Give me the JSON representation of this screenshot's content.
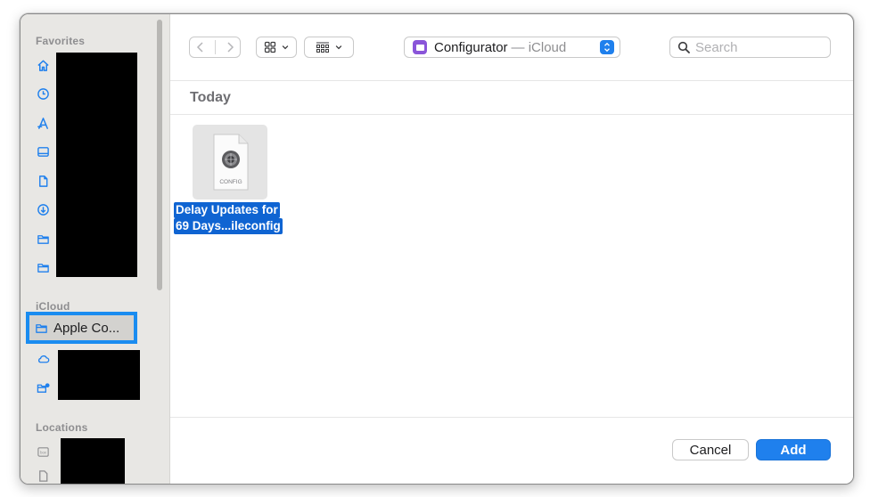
{
  "sidebar": {
    "favorites_label": "Favorites",
    "icloud_label": "iCloud",
    "locations_label": "Locations",
    "favorites_icons": [
      "home-icon",
      "recents-clock-icon",
      "applications-icon",
      "desktop-icon",
      "documents-icon",
      "downloads-icon",
      "folder-icon",
      "folder-icon"
    ],
    "selected_item": {
      "label": "Apple Co...",
      "icon": "folder-icon"
    },
    "icloud_icons": [
      "icloud-drive-icon",
      "shared-folder-icon"
    ],
    "locations_icons": [
      "box-drive-icon",
      "document-icon"
    ]
  },
  "toolbar": {
    "location": {
      "title": "Configurator",
      "subtitle": "— iCloud"
    },
    "search": {
      "placeholder": "Search"
    }
  },
  "content": {
    "group_title": "Today",
    "files": [
      {
        "name_line1": "Delay Updates for",
        "name_line2": "69 Days...ileconfig",
        "type_label": "CONFIG"
      }
    ]
  },
  "footer": {
    "cancel_label": "Cancel",
    "add_label": "Add"
  },
  "colors": {
    "accent": "#1f80ed",
    "sidebar_bg": "#e8e7e4",
    "selection": "#0f64d2",
    "callout": "#1a8cf0"
  }
}
